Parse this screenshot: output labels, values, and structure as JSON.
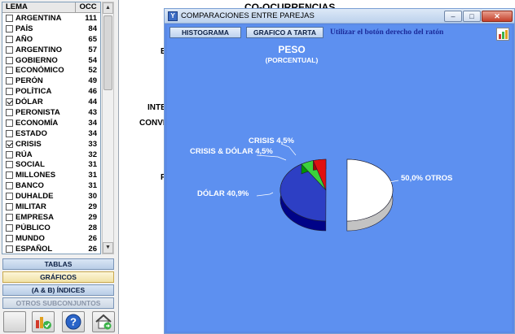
{
  "main_title": "CO-OCURRENCIAS",
  "ghost_labels": [
    "B",
    "INTE",
    "CONVE",
    "F"
  ],
  "list": {
    "header_lema": "LEMA",
    "header_occ": "OCC",
    "rows": [
      {
        "lema": "ARGENTINA",
        "occ": "111",
        "checked": false
      },
      {
        "lema": "PAÍS",
        "occ": "84",
        "checked": false
      },
      {
        "lema": "AÑO",
        "occ": "65",
        "checked": false
      },
      {
        "lema": "ARGENTINO",
        "occ": "57",
        "checked": false
      },
      {
        "lema": "GOBIERNO",
        "occ": "54",
        "checked": false
      },
      {
        "lema": "ECONÓMICO",
        "occ": "52",
        "checked": false
      },
      {
        "lema": "PERÓN",
        "occ": "49",
        "checked": false
      },
      {
        "lema": "POLÍTICA",
        "occ": "46",
        "checked": false
      },
      {
        "lema": "DÓLAR",
        "occ": "44",
        "checked": true
      },
      {
        "lema": "PERONISTA",
        "occ": "43",
        "checked": false
      },
      {
        "lema": "ECONOMÍA",
        "occ": "34",
        "checked": false
      },
      {
        "lema": "ESTADO",
        "occ": "34",
        "checked": false
      },
      {
        "lema": "CRISIS",
        "occ": "33",
        "checked": true
      },
      {
        "lema": "RÚA",
        "occ": "32",
        "checked": false
      },
      {
        "lema": "SOCIAL",
        "occ": "31",
        "checked": false
      },
      {
        "lema": "MILLONES",
        "occ": "31",
        "checked": false
      },
      {
        "lema": "BANCO",
        "occ": "31",
        "checked": false
      },
      {
        "lema": "DUHALDE",
        "occ": "30",
        "checked": false
      },
      {
        "lema": "MILITAR",
        "occ": "29",
        "checked": false
      },
      {
        "lema": "EMPRESA",
        "occ": "29",
        "checked": false
      },
      {
        "lema": "PÚBLICO",
        "occ": "28",
        "checked": false
      },
      {
        "lema": "MUNDO",
        "occ": "26",
        "checked": false
      },
      {
        "lema": "ESPAÑOL",
        "occ": "26",
        "checked": false
      }
    ]
  },
  "nav": {
    "tablas": "TABLAS",
    "graficos": "GRÁFICOS",
    "indices": "(A & B)  ÍNDICES",
    "otros": "OTROS SUBCONJUNTOS"
  },
  "tools": [
    "chart-icon",
    "help-icon",
    "home-icon"
  ],
  "window": {
    "title": "COMPARACIONES ENTRE PAREJAS",
    "btn_histograma": "HISTOGRAMA",
    "btn_tarta": "GRAFICO A TARTA",
    "hint": "Utilizar el botón derecho del ratón"
  },
  "chart_data": {
    "type": "pie",
    "title": "PESO",
    "subtitle": "(PORCENTUAL)",
    "slices": [
      {
        "name": "OTROS",
        "value": 50.0,
        "label": "50,0%  OTROS",
        "color": "#ffffff"
      },
      {
        "name": "DÓLAR",
        "value": 40.9,
        "label": "DÓLAR  40,9%",
        "color": "#2d3fc4"
      },
      {
        "name": "CRISIS & DÓLAR",
        "value": 4.5,
        "label": "CRISIS & DÓLAR  4,5%",
        "color": "#3bd13b"
      },
      {
        "name": "CRISIS",
        "value": 4.5,
        "label": "CRISIS  4,5%",
        "color": "#e01010"
      }
    ]
  },
  "colors": {
    "window_bg": "#5d90f0",
    "title_bg": "#dde9f7",
    "active_nav": "#f0e1a6"
  }
}
